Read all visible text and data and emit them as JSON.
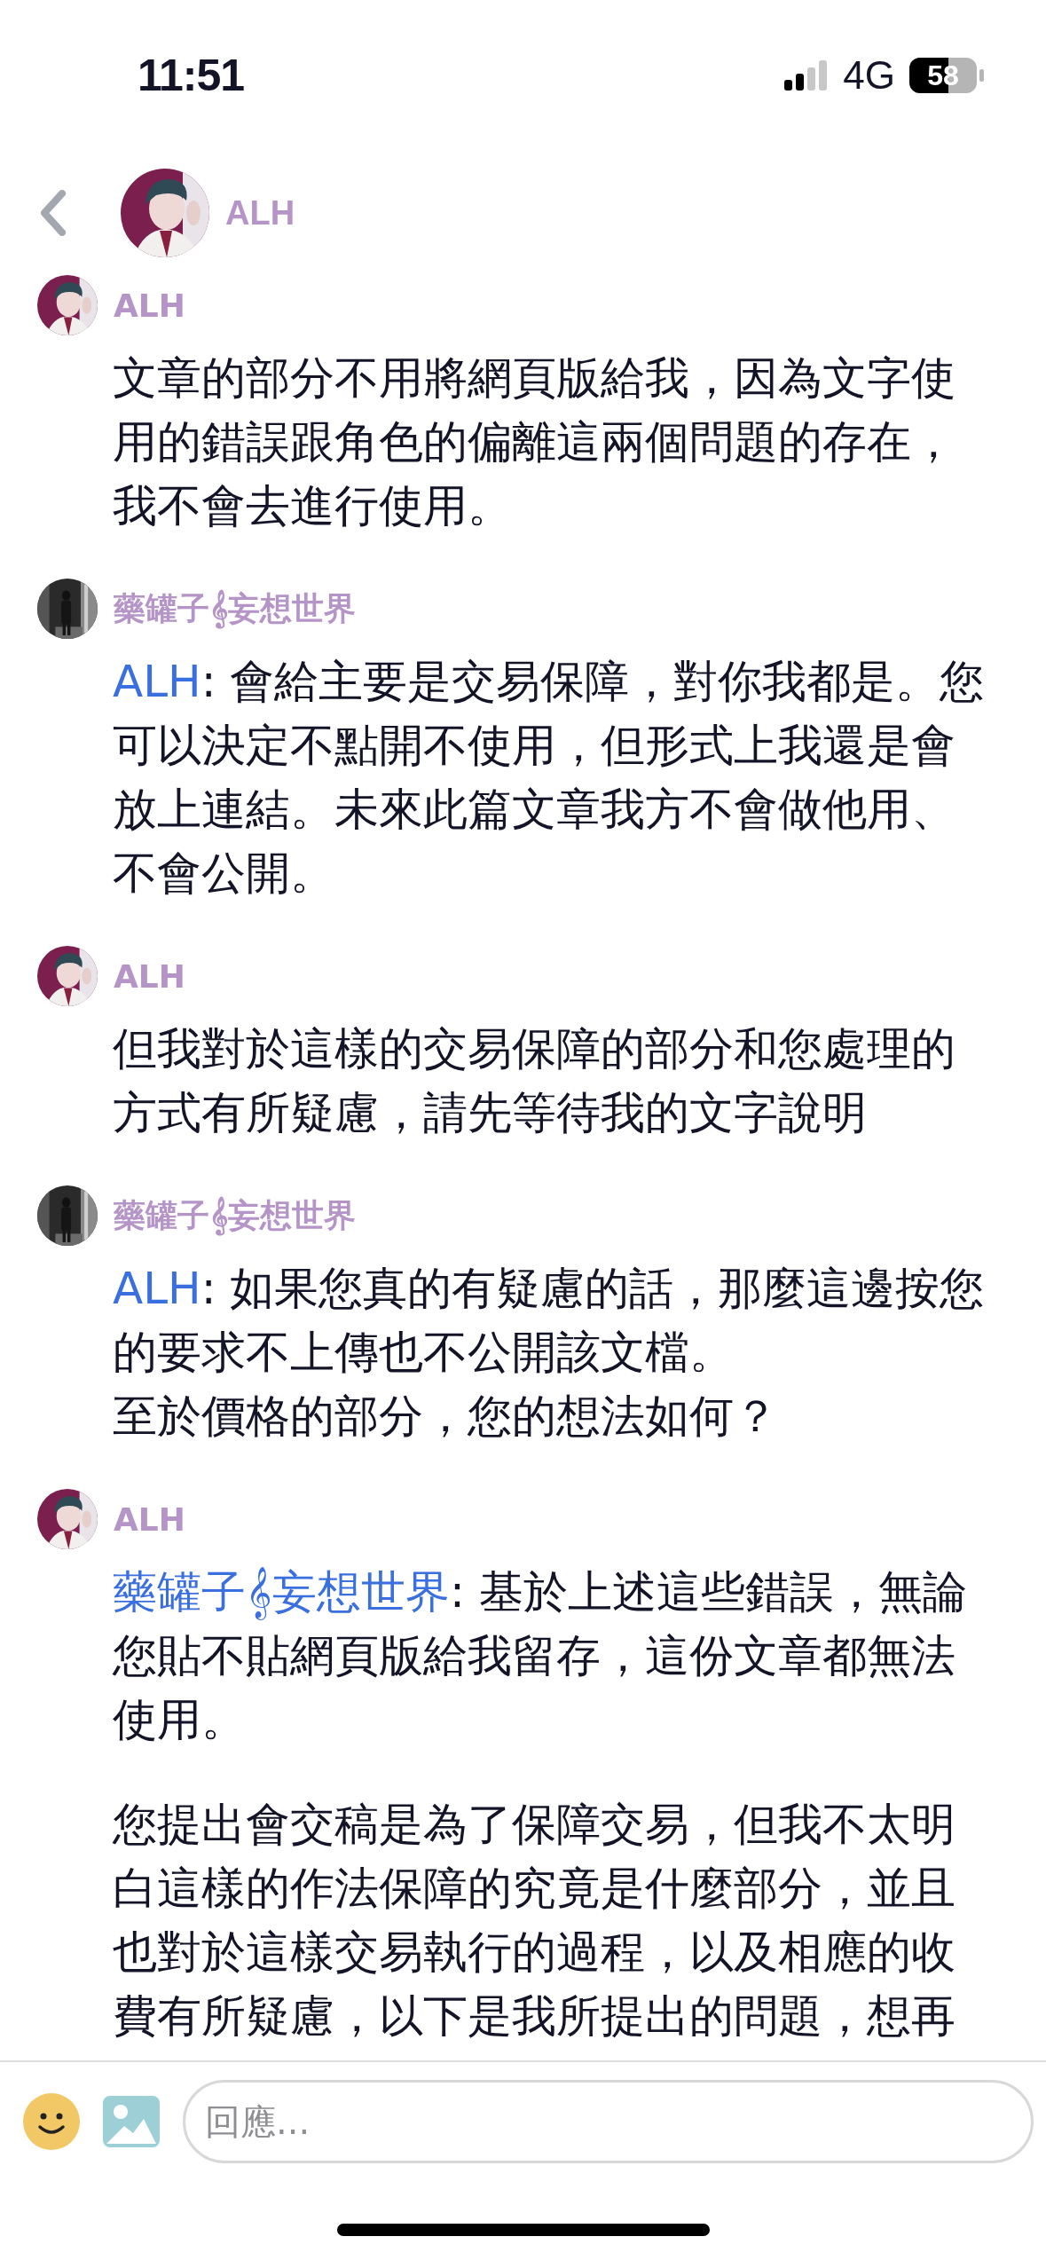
{
  "status_bar": {
    "time": "11:51",
    "network": "4G",
    "battery": "58"
  },
  "header": {
    "name": "ALH"
  },
  "messages": [
    {
      "sender": "ALH",
      "paragraphs": [
        {
          "lines": [
            "文章的部分不用將網頁版給我，因為文字使用的錯誤跟角色的偏離這兩個問題的存在，我不會去進行使用。"
          ]
        }
      ]
    },
    {
      "sender": "藥罐子𝄞妄想世界",
      "paragraphs": [
        {
          "mention": "ALH",
          "lines": [
            ": 會給主要是交易保障，對你我都是。您可以決定不點開不使用，但形式上我還是會放上連結。未來此篇文章我方不會做他用、不會公開。"
          ]
        }
      ]
    },
    {
      "sender": "ALH",
      "paragraphs": [
        {
          "lines": [
            "但我對於這樣的交易保障的部分和您處理的方式有所疑慮，請先等待我的文字說明"
          ]
        }
      ]
    },
    {
      "sender": "藥罐子𝄞妄想世界",
      "paragraphs": [
        {
          "mention": "ALH",
          "lines": [
            ": 如果您真的有疑慮的話，那麼這邊按您的要求不上傳也不公開該文檔。",
            "至於價格的部分，您的想法如何？"
          ]
        }
      ]
    },
    {
      "sender": "ALH",
      "paragraphs": [
        {
          "mention": "藥罐子𝄞妄想世界",
          "lines": [
            ": 基於上述這些錯誤，無論您貼不貼網頁版給我留存，這份文章都無法使用。"
          ]
        },
        {
          "lines": [
            "您提出會交稿是為了保障交易，但我不太明白這樣的作法保障的究竟是什麼部分，並且也對於這樣交易執行的過程，以及相應的收費有所疑慮，以下是我所提出的問題，想再"
          ]
        }
      ]
    }
  ],
  "composer": {
    "placeholder": "回應..."
  }
}
